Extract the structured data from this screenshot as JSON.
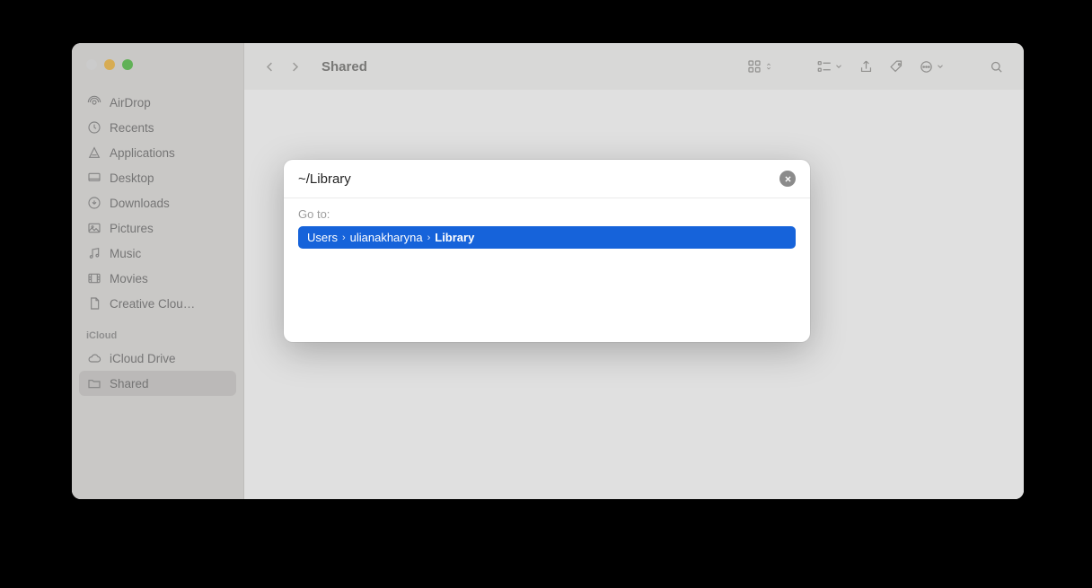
{
  "window": {
    "title": "Shared",
    "traffic": {
      "close": "#e5e5e5",
      "minimize": "#f4bf4f",
      "zoom": "#61c554"
    }
  },
  "sidebar": {
    "favorites": [
      {
        "name": "airdrop",
        "label": "AirDrop"
      },
      {
        "name": "recents",
        "label": "Recents"
      },
      {
        "name": "applications",
        "label": "Applications"
      },
      {
        "name": "desktop",
        "label": "Desktop"
      },
      {
        "name": "downloads",
        "label": "Downloads"
      },
      {
        "name": "pictures",
        "label": "Pictures"
      },
      {
        "name": "music",
        "label": "Music"
      },
      {
        "name": "movies",
        "label": "Movies"
      },
      {
        "name": "creative-cloud",
        "label": "Creative Clou…"
      }
    ],
    "section_icloud": "iCloud",
    "icloud": [
      {
        "name": "icloud-drive",
        "label": "iCloud Drive"
      },
      {
        "name": "shared",
        "label": "Shared",
        "selected": true
      }
    ]
  },
  "sheet": {
    "input_value": "~/Library",
    "goto_label": "Go to:",
    "path": [
      "Users",
      "ulianakharyna",
      "Library"
    ]
  }
}
